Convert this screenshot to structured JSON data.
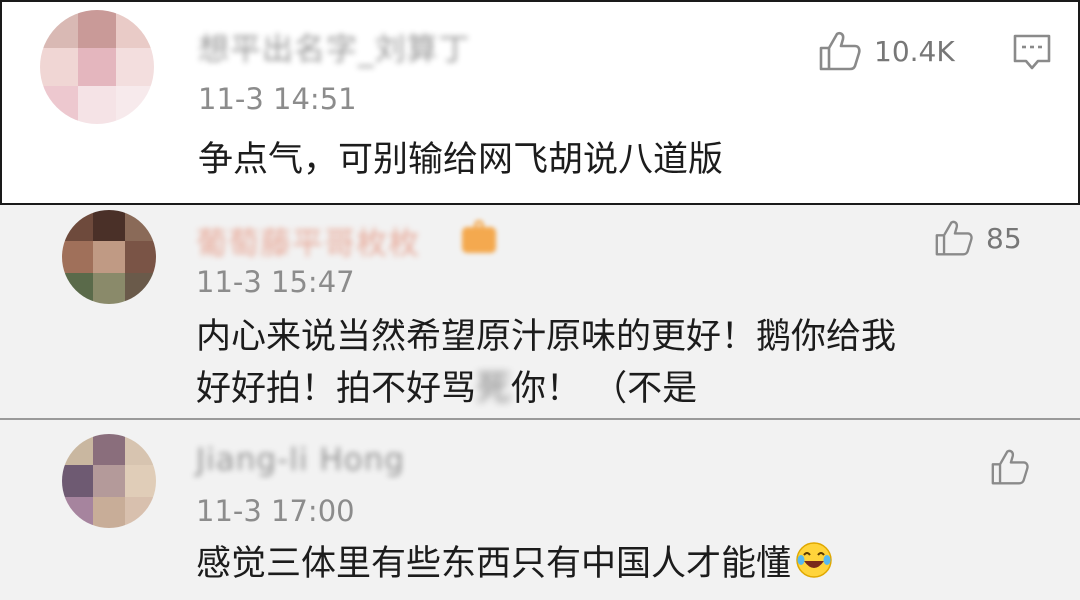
{
  "comments": [
    {
      "username": "想平出名字_刘算丁",
      "time": "11-3 14:51",
      "text_lines": [
        "争点气，可别输给网飞胡说八道版"
      ],
      "likes": "10.4K",
      "avatar_colors": [
        "#d9b9b4",
        "#c99a98",
        "#e9cbc7",
        "#f0d6d4",
        "#e4b6be",
        "#f3dede",
        "#edc8cf",
        "#f5e3e6",
        "#f7eaec"
      ]
    },
    {
      "username": "葡萄藤平哥枚枚",
      "time": "11-3 15:47",
      "text_lines": [
        "内心来说当然希望原汁原味的更好！鹅你给我",
        "好好拍！拍不好骂",
        "你！  （不是"
      ],
      "blurred_glyph": "死",
      "likes": "85",
      "avatar_colors": [
        "#6e4a3c",
        "#4a3028",
        "#8a6a58",
        "#a0705a",
        "#c09a84",
        "#7a5446",
        "#5a6a4a",
        "#8a8a6a",
        "#6a5a4a"
      ]
    },
    {
      "username": "Jiang-li Hong",
      "time": "11-3 17:00",
      "text_lines": [
        "感觉三体里有些东西只有中国人才能懂"
      ],
      "avatar_colors": [
        "#c9b7a0",
        "#8a6e7c",
        "#d7c4b0",
        "#6e5a72",
        "#b49a9a",
        "#e0cdb8",
        "#a6849e",
        "#c8ad98",
        "#d8c0ae"
      ]
    }
  ],
  "icons": {
    "like": "thumbs-up-icon",
    "reply": "comment-icon",
    "emoji": "laughing-crying-emoji-icon"
  },
  "colors": {
    "time": "#8c8c8c",
    "icon": "#8a8a8a",
    "badge": "#f4a94f"
  }
}
